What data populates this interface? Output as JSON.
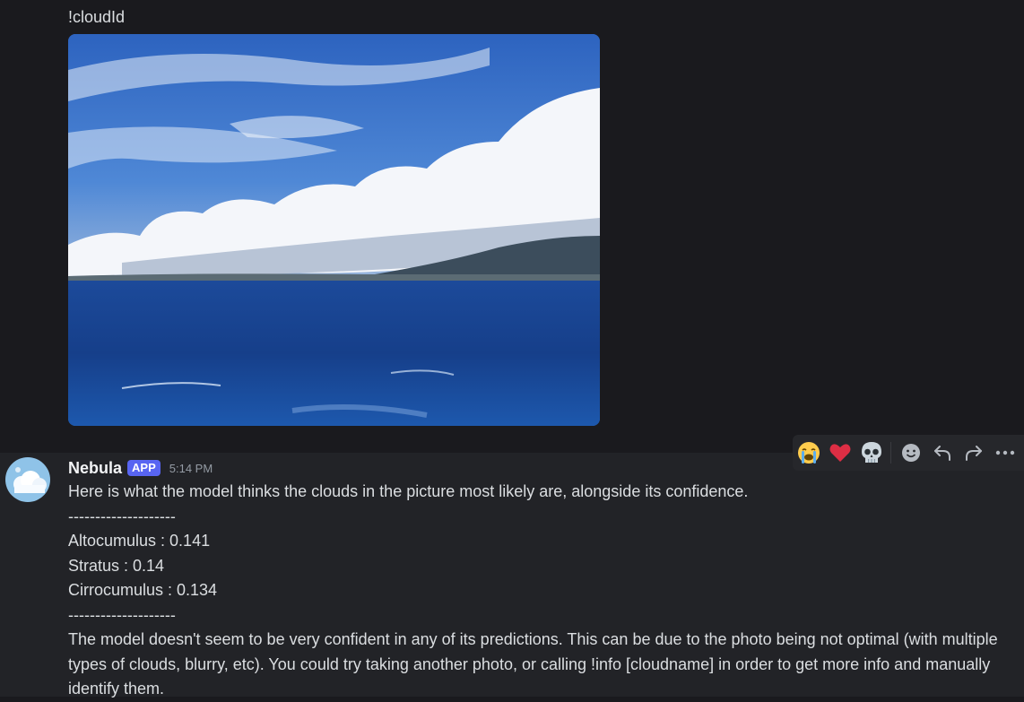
{
  "previous_message": {
    "text": "!cloudId",
    "image_alt": "Photo of ocean with clouds over a distant mountain"
  },
  "message": {
    "username": "Nebula",
    "badge": "APP",
    "timestamp": "5:14 PM",
    "intro": "Here is what the model thinks the clouds in the picture most likely are, alongside its confidence.",
    "divider_top": "--------------------",
    "predictions": [
      "Altocumulus : 0.141",
      "Stratus : 0.14",
      "Cirrocumulus : 0.134"
    ],
    "divider_bottom": "--------------------",
    "conclusion": "The model doesn't seem to be very confident in any of its predictions. This can be due to the photo being not optimal (with multiple types of clouds, blurry, etc). You could try taking another photo, or calling !info [cloudname] in order to get more info and manually identify them."
  },
  "toolbar": {
    "reactions": [
      "loudly-crying-face-icon",
      "red-heart-icon",
      "skull-icon"
    ],
    "actions": [
      "add-reaction-icon",
      "reply-icon",
      "forward-icon",
      "more-icon"
    ]
  },
  "colors": {
    "background": "#1a1a1e",
    "highlight": "#222327",
    "badge": "#5865f2",
    "text": "#dbdee1",
    "muted": "#949ba4"
  }
}
